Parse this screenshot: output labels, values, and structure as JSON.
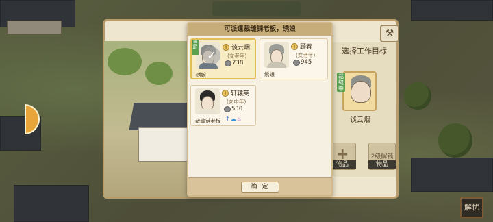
{
  "dialog": {
    "header": "可派遣裁缝铺老板，绣娘",
    "confirm_label": "确 定",
    "cards": [
      {
        "name": "谈云烟",
        "age": "(女老年)",
        "coins": "738",
        "role": "绣娘",
        "tag": "当前",
        "selected": true
      },
      {
        "name": "顾春",
        "age": "(女老年)",
        "coins": "945",
        "role": "绣娘",
        "tag": "",
        "selected": false
      },
      {
        "name": "轩辕芙",
        "age": "(女中年)",
        "coins": "530",
        "role": "裁缝铺老板",
        "tag": "",
        "selected": false
      }
    ]
  },
  "target_panel": {
    "title": "选择工作目标",
    "badge": "裁缝中",
    "name": "谈云烟",
    "slots": [
      {
        "label": "物品",
        "top": ""
      },
      {
        "label": "物品",
        "top": "2级解锁"
      }
    ]
  },
  "stamp": "解忧",
  "level_icon_text": "I"
}
